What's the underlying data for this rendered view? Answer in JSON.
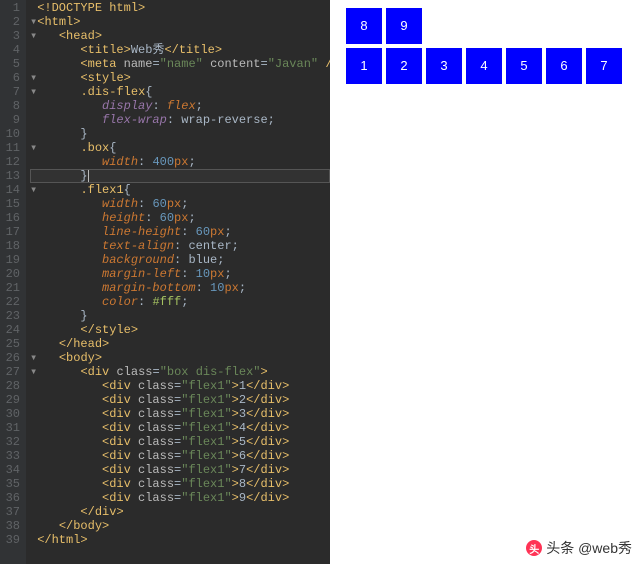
{
  "editor": {
    "lineCount": 39,
    "activeLine": 13,
    "lines": [
      {
        "tokens": [
          [
            "<!",
            "t-doc"
          ],
          [
            "DOCTYPE html",
            "t-doc"
          ],
          [
            ">",
            "t-doc"
          ]
        ]
      },
      {
        "indent": 0,
        "fold": "▾",
        "tokens": [
          [
            "<",
            "t-tag"
          ],
          [
            "html",
            "t-tag"
          ],
          [
            ">",
            "t-tag"
          ]
        ]
      },
      {
        "indent": 1,
        "fold": "▾",
        "tokens": [
          [
            "<",
            "t-tag"
          ],
          [
            "head",
            "t-tag"
          ],
          [
            ">",
            "t-tag"
          ]
        ]
      },
      {
        "indent": 2,
        "tokens": [
          [
            "<",
            "t-tag"
          ],
          [
            "title",
            "t-tag"
          ],
          [
            ">",
            "t-tag"
          ],
          [
            "Web秀",
            "t-text"
          ],
          [
            "</",
            "t-tag"
          ],
          [
            "title",
            "t-tag"
          ],
          [
            ">",
            "t-tag"
          ]
        ]
      },
      {
        "indent": 2,
        "tokens": [
          [
            "<",
            "t-tag"
          ],
          [
            "meta ",
            "t-tag"
          ],
          [
            "name",
            "t-attr"
          ],
          [
            "=",
            "t-punc"
          ],
          [
            "\"name\"",
            "t-str"
          ],
          [
            " ",
            "t-punc"
          ],
          [
            "content",
            "t-attr"
          ],
          [
            "=",
            "t-punc"
          ],
          [
            "\"Javan\"",
            "t-str"
          ],
          [
            " />",
            "t-tag"
          ]
        ]
      },
      {
        "indent": 2,
        "fold": "▾",
        "tokens": [
          [
            "<",
            "t-tag"
          ],
          [
            "style",
            "t-tag"
          ],
          [
            ">",
            "t-tag"
          ]
        ]
      },
      {
        "indent": 2,
        "fold": "▾",
        "tokens": [
          [
            ".dis-flex",
            "t-sel"
          ],
          [
            "{",
            "t-punc"
          ]
        ]
      },
      {
        "indent": 3,
        "tokens": [
          [
            "display",
            "t-prop"
          ],
          [
            ": ",
            "t-punc"
          ],
          [
            "flex",
            "t-propn"
          ],
          [
            ";",
            "t-punc"
          ]
        ]
      },
      {
        "indent": 3,
        "tokens": [
          [
            "flex-wrap",
            "t-prop"
          ],
          [
            ": ",
            "t-punc"
          ],
          [
            "wrap-reverse",
            "t-val"
          ],
          [
            ";",
            "t-punc"
          ]
        ]
      },
      {
        "indent": 2,
        "tokens": [
          [
            "}",
            "t-punc"
          ]
        ]
      },
      {
        "indent": 2,
        "fold": "▾",
        "tokens": [
          [
            ".box",
            "t-sel"
          ],
          [
            "{",
            "t-punc"
          ]
        ]
      },
      {
        "indent": 3,
        "tokens": [
          [
            "width",
            "t-propn"
          ],
          [
            ": ",
            "t-punc"
          ],
          [
            "400",
            "t-num"
          ],
          [
            "px",
            "t-unit"
          ],
          [
            ";",
            "t-punc"
          ]
        ]
      },
      {
        "indent": 2,
        "active": true,
        "cursor": true,
        "tokens": [
          [
            "}",
            "t-punc"
          ]
        ]
      },
      {
        "indent": 2,
        "fold": "▾",
        "tokens": [
          [
            ".flex1",
            "t-sel"
          ],
          [
            "{",
            "t-punc"
          ]
        ]
      },
      {
        "indent": 3,
        "tokens": [
          [
            "width",
            "t-propn"
          ],
          [
            ": ",
            "t-punc"
          ],
          [
            "60",
            "t-num"
          ],
          [
            "px",
            "t-unit"
          ],
          [
            ";",
            "t-punc"
          ]
        ]
      },
      {
        "indent": 3,
        "tokens": [
          [
            "height",
            "t-propn"
          ],
          [
            ": ",
            "t-punc"
          ],
          [
            "60",
            "t-num"
          ],
          [
            "px",
            "t-unit"
          ],
          [
            ";",
            "t-punc"
          ]
        ]
      },
      {
        "indent": 3,
        "tokens": [
          [
            "line-height",
            "t-propn"
          ],
          [
            ": ",
            "t-punc"
          ],
          [
            "60",
            "t-num"
          ],
          [
            "px",
            "t-unit"
          ],
          [
            ";",
            "t-punc"
          ]
        ]
      },
      {
        "indent": 3,
        "tokens": [
          [
            "text-align",
            "t-propn"
          ],
          [
            ": ",
            "t-punc"
          ],
          [
            "center",
            "t-val"
          ],
          [
            ";",
            "t-punc"
          ]
        ]
      },
      {
        "indent": 3,
        "tokens": [
          [
            "background",
            "t-propn"
          ],
          [
            ": ",
            "t-punc"
          ],
          [
            "blue",
            "t-val"
          ],
          [
            ";",
            "t-punc"
          ]
        ]
      },
      {
        "indent": 3,
        "tokens": [
          [
            "margin-left",
            "t-propn"
          ],
          [
            ": ",
            "t-punc"
          ],
          [
            "10",
            "t-num"
          ],
          [
            "px",
            "t-unit"
          ],
          [
            ";",
            "t-punc"
          ]
        ]
      },
      {
        "indent": 3,
        "tokens": [
          [
            "margin-bottom",
            "t-propn"
          ],
          [
            ": ",
            "t-punc"
          ],
          [
            "10",
            "t-num"
          ],
          [
            "px",
            "t-unit"
          ],
          [
            ";",
            "t-punc"
          ]
        ]
      },
      {
        "indent": 3,
        "tokens": [
          [
            "color",
            "t-propn"
          ],
          [
            ": ",
            "t-punc"
          ],
          [
            "#fff",
            "t-color"
          ],
          [
            ";",
            "t-punc"
          ]
        ]
      },
      {
        "indent": 2,
        "tokens": [
          [
            "}",
            "t-punc"
          ]
        ]
      },
      {
        "indent": 2,
        "tokens": [
          [
            "</",
            "t-tag"
          ],
          [
            "style",
            "t-tag"
          ],
          [
            ">",
            "t-tag"
          ]
        ]
      },
      {
        "indent": 1,
        "tokens": [
          [
            "</",
            "t-tag"
          ],
          [
            "head",
            "t-tag"
          ],
          [
            ">",
            "t-tag"
          ]
        ]
      },
      {
        "indent": 1,
        "fold": "▾",
        "tokens": [
          [
            "<",
            "t-tag"
          ],
          [
            "body",
            "t-tag"
          ],
          [
            ">",
            "t-tag"
          ]
        ]
      },
      {
        "indent": 2,
        "fold": "▾",
        "tokens": [
          [
            "<",
            "t-tag"
          ],
          [
            "div ",
            "t-tag"
          ],
          [
            "class",
            "t-attr"
          ],
          [
            "=",
            "t-punc"
          ],
          [
            "\"box dis-flex\"",
            "t-str"
          ],
          [
            ">",
            "t-tag"
          ]
        ]
      },
      {
        "indent": 3,
        "tokens": [
          [
            "<",
            "t-tag"
          ],
          [
            "div ",
            "t-tag"
          ],
          [
            "class",
            "t-attr"
          ],
          [
            "=",
            "t-punc"
          ],
          [
            "\"flex1\"",
            "t-str"
          ],
          [
            ">",
            "t-tag"
          ],
          [
            "1",
            "t-text"
          ],
          [
            "</",
            "t-tag"
          ],
          [
            "div",
            "t-tag"
          ],
          [
            ">",
            "t-tag"
          ]
        ]
      },
      {
        "indent": 3,
        "tokens": [
          [
            "<",
            "t-tag"
          ],
          [
            "div ",
            "t-tag"
          ],
          [
            "class",
            "t-attr"
          ],
          [
            "=",
            "t-punc"
          ],
          [
            "\"flex1\"",
            "t-str"
          ],
          [
            ">",
            "t-tag"
          ],
          [
            "2",
            "t-text"
          ],
          [
            "</",
            "t-tag"
          ],
          [
            "div",
            "t-tag"
          ],
          [
            ">",
            "t-tag"
          ]
        ]
      },
      {
        "indent": 3,
        "tokens": [
          [
            "<",
            "t-tag"
          ],
          [
            "div ",
            "t-tag"
          ],
          [
            "class",
            "t-attr"
          ],
          [
            "=",
            "t-punc"
          ],
          [
            "\"flex1\"",
            "t-str"
          ],
          [
            ">",
            "t-tag"
          ],
          [
            "3",
            "t-text"
          ],
          [
            "</",
            "t-tag"
          ],
          [
            "div",
            "t-tag"
          ],
          [
            ">",
            "t-tag"
          ]
        ]
      },
      {
        "indent": 3,
        "tokens": [
          [
            "<",
            "t-tag"
          ],
          [
            "div ",
            "t-tag"
          ],
          [
            "class",
            "t-attr"
          ],
          [
            "=",
            "t-punc"
          ],
          [
            "\"flex1\"",
            "t-str"
          ],
          [
            ">",
            "t-tag"
          ],
          [
            "4",
            "t-text"
          ],
          [
            "</",
            "t-tag"
          ],
          [
            "div",
            "t-tag"
          ],
          [
            ">",
            "t-tag"
          ]
        ]
      },
      {
        "indent": 3,
        "tokens": [
          [
            "<",
            "t-tag"
          ],
          [
            "div ",
            "t-tag"
          ],
          [
            "class",
            "t-attr"
          ],
          [
            "=",
            "t-punc"
          ],
          [
            "\"flex1\"",
            "t-str"
          ],
          [
            ">",
            "t-tag"
          ],
          [
            "5",
            "t-text"
          ],
          [
            "</",
            "t-tag"
          ],
          [
            "div",
            "t-tag"
          ],
          [
            ">",
            "t-tag"
          ]
        ]
      },
      {
        "indent": 3,
        "tokens": [
          [
            "<",
            "t-tag"
          ],
          [
            "div ",
            "t-tag"
          ],
          [
            "class",
            "t-attr"
          ],
          [
            "=",
            "t-punc"
          ],
          [
            "\"flex1\"",
            "t-str"
          ],
          [
            ">",
            "t-tag"
          ],
          [
            "6",
            "t-text"
          ],
          [
            "</",
            "t-tag"
          ],
          [
            "div",
            "t-tag"
          ],
          [
            ">",
            "t-tag"
          ]
        ]
      },
      {
        "indent": 3,
        "tokens": [
          [
            "<",
            "t-tag"
          ],
          [
            "div ",
            "t-tag"
          ],
          [
            "class",
            "t-attr"
          ],
          [
            "=",
            "t-punc"
          ],
          [
            "\"flex1\"",
            "t-str"
          ],
          [
            ">",
            "t-tag"
          ],
          [
            "7",
            "t-text"
          ],
          [
            "</",
            "t-tag"
          ],
          [
            "div",
            "t-tag"
          ],
          [
            ">",
            "t-tag"
          ]
        ]
      },
      {
        "indent": 3,
        "tokens": [
          [
            "<",
            "t-tag"
          ],
          [
            "div ",
            "t-tag"
          ],
          [
            "class",
            "t-attr"
          ],
          [
            "=",
            "t-punc"
          ],
          [
            "\"flex1\"",
            "t-str"
          ],
          [
            ">",
            "t-tag"
          ],
          [
            "8",
            "t-text"
          ],
          [
            "</",
            "t-tag"
          ],
          [
            "div",
            "t-tag"
          ],
          [
            ">",
            "t-tag"
          ]
        ]
      },
      {
        "indent": 3,
        "tokens": [
          [
            "<",
            "t-tag"
          ],
          [
            "div ",
            "t-tag"
          ],
          [
            "class",
            "t-attr"
          ],
          [
            "=",
            "t-punc"
          ],
          [
            "\"flex1\"",
            "t-str"
          ],
          [
            ">",
            "t-tag"
          ],
          [
            "9",
            "t-text"
          ],
          [
            "</",
            "t-tag"
          ],
          [
            "div",
            "t-tag"
          ],
          [
            ">",
            "t-tag"
          ]
        ]
      },
      {
        "indent": 2,
        "tokens": [
          [
            "</",
            "t-tag"
          ],
          [
            "div",
            "t-tag"
          ],
          [
            ">",
            "t-tag"
          ]
        ]
      },
      {
        "indent": 1,
        "tokens": [
          [
            "</",
            "t-tag"
          ],
          [
            "body",
            "t-tag"
          ],
          [
            ">",
            "t-tag"
          ]
        ]
      },
      {
        "indent": 0,
        "tokens": [
          [
            "</",
            "t-tag"
          ],
          [
            "html",
            "t-tag"
          ],
          [
            ">",
            "t-tag"
          ]
        ]
      }
    ]
  },
  "preview": {
    "items": [
      "1",
      "2",
      "3",
      "4",
      "5",
      "6",
      "7",
      "8",
      "9"
    ]
  },
  "watermark": {
    "text": "头条 @web秀"
  }
}
